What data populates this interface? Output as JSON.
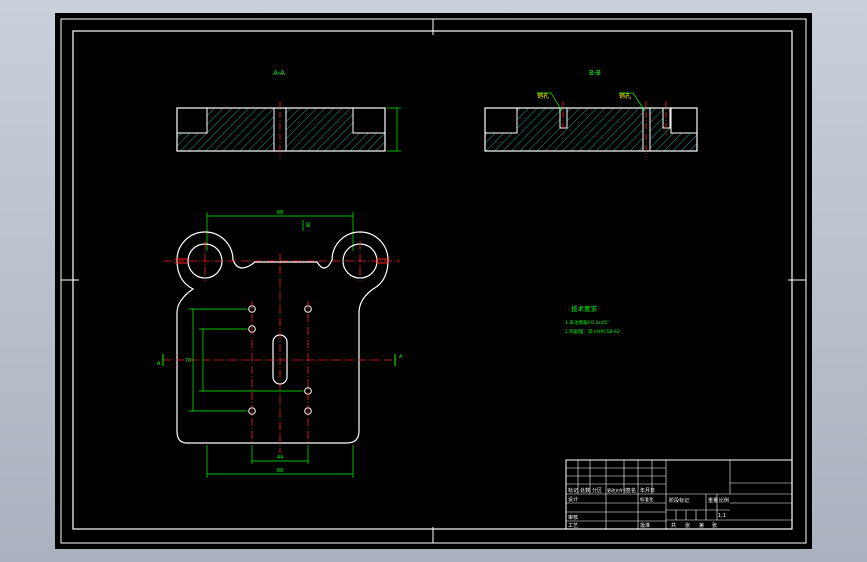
{
  "colors": {
    "background": "#000000",
    "frame": "#ffffff",
    "outline": "#ffffff",
    "hatch": "#2ec4c4",
    "dimension": "#00ff00",
    "centerline": "#ff2020",
    "text": "#00ff00",
    "leader_text": "#ffff00"
  },
  "section_labels": {
    "left": "A-A",
    "right": "B-B"
  },
  "leaders": {
    "label": "销孔"
  },
  "plan_view": {
    "section_mark_left": "A",
    "section_mark_right": "A",
    "dim_top": "88",
    "dim_top_hint": "B",
    "dim_bottom": "88",
    "dim_bottom_inner": "44",
    "dim_left": "70"
  },
  "tech_requirements": {
    "title": "技术要求",
    "line1": "1.未注倒角C0.5x45°",
    "line2": "2.热处理：淬火HRC58-62"
  },
  "title_block": {
    "rev_headers": [
      "标记",
      "处数",
      "分区",
      "更改文件号",
      "签名",
      "年月日"
    ],
    "left_labels": [
      "设计",
      "审核",
      "工艺"
    ],
    "std_label": "标准化",
    "approve_label": "批准",
    "stage_headers": [
      "阶段标记",
      "重量",
      "比例"
    ],
    "scale_value": "1:1",
    "sheet_labels": [
      "共",
      "张",
      "第",
      "张"
    ]
  }
}
